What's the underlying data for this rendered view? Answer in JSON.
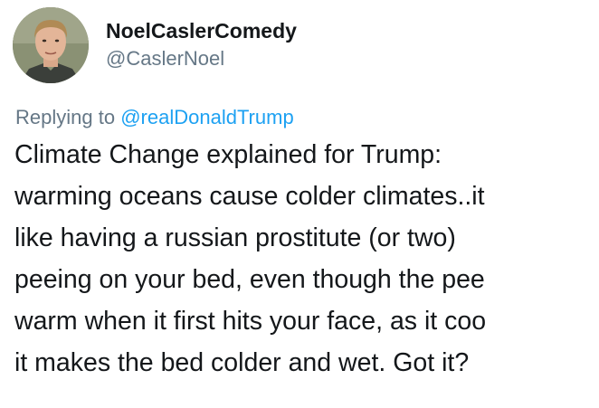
{
  "user": {
    "display_name": "NoelCaslerComedy",
    "handle": "@CaslerNoel"
  },
  "reply": {
    "prefix": "Replying to",
    "mention": "@realDonaldTrump"
  },
  "tweet": {
    "lines": [
      "Climate Change explained for Trump:",
      "warming oceans cause colder climates..it",
      "like having a russian prostitute (or two)",
      "peeing on your bed, even though the pee",
      "warm when it first hits your face, as it coo",
      "it makes the bed colder and wet. Got it?"
    ]
  },
  "colors": {
    "text": "#14171a",
    "secondary": "#657786",
    "link": "#1da1f2"
  }
}
